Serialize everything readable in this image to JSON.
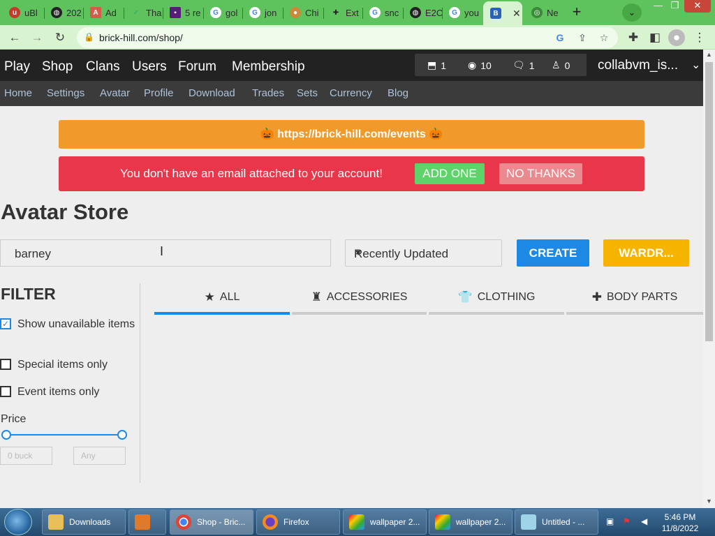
{
  "browser": {
    "tabs": [
      {
        "label": "uBl",
        "icon": "red-shield-icon"
      },
      {
        "label": "202",
        "icon": "globe-icon"
      },
      {
        "label": "Ad",
        "icon": "extension-icon"
      },
      {
        "label": "Tha",
        "icon": "check-icon"
      },
      {
        "label": "5 re",
        "icon": "purple-square-icon"
      },
      {
        "label": "gol",
        "icon": "google-icon"
      },
      {
        "label": "jon",
        "icon": "google-icon"
      },
      {
        "label": "Chi",
        "icon": "cookie-icon"
      },
      {
        "label": "Ext",
        "icon": "puzzle-icon"
      },
      {
        "label": "snc",
        "icon": "google-icon"
      },
      {
        "label": "E2C",
        "icon": "globe-icon"
      },
      {
        "label": "you",
        "icon": "google-icon"
      },
      {
        "label": "",
        "icon": "brickhill-icon",
        "active": true
      },
      {
        "label": "Ne",
        "icon": "chrome-icon"
      }
    ],
    "url": "brick-hill.com/shop/"
  },
  "site": {
    "nav_primary": [
      "Play",
      "Shop",
      "Clans",
      "Users",
      "Forum",
      "Membership"
    ],
    "stats": {
      "bricks": "1",
      "bucks": "10",
      "messages": "1",
      "friends": "0"
    },
    "username": "collabvm_is...",
    "nav_secondary": [
      "Home",
      "Settings",
      "Avatar",
      "Profile",
      "Download",
      "Trades",
      "Sets",
      "Currency",
      "Blog"
    ]
  },
  "banners": {
    "events_text": "🎃 https://brick-hill.com/events 🎃",
    "email_text": "You don't have an email attached to your account!",
    "add_one": "ADD ONE",
    "no_thanks": "NO THANKS"
  },
  "store": {
    "title": "Avatar Store",
    "search_value": "barney",
    "sort_value": "Recently Updated",
    "create_label": "CREATE",
    "wardrobe_label": "WARDR...",
    "filter_title": "FILTER",
    "filters": [
      {
        "label": "Show unavailable items",
        "checked": true
      },
      {
        "label": "Special items only",
        "checked": false
      },
      {
        "label": "Event items only",
        "checked": false
      }
    ],
    "price_label": "Price",
    "price_min_placeholder": "0 buck",
    "price_max_placeholder": "Any",
    "categories": [
      {
        "label": "ALL",
        "icon": "star-icon"
      },
      {
        "label": "ACCESSORIES",
        "icon": "hat-icon"
      },
      {
        "label": "CLOTHING",
        "icon": "shirt-icon"
      },
      {
        "label": "BODY PARTS",
        "icon": "puzzle-piece-icon"
      }
    ]
  },
  "colors": {
    "brand_dark": "#222222",
    "events_orange": "#f09a2b",
    "alert_red": "#e8364a",
    "create_blue": "#1e88e5",
    "wardrobe_yellow": "#f5b400",
    "browser_green": "#5fc35d"
  },
  "taskbar": {
    "items": [
      {
        "label": "Downloads"
      },
      {
        "label": ""
      },
      {
        "label": "Shop - Bric..."
      },
      {
        "label": "Firefox"
      },
      {
        "label": "wallpaper 2..."
      },
      {
        "label": "wallpaper 2..."
      },
      {
        "label": "Untitled - ..."
      }
    ],
    "time": "5:46 PM",
    "date": "11/8/2022"
  }
}
